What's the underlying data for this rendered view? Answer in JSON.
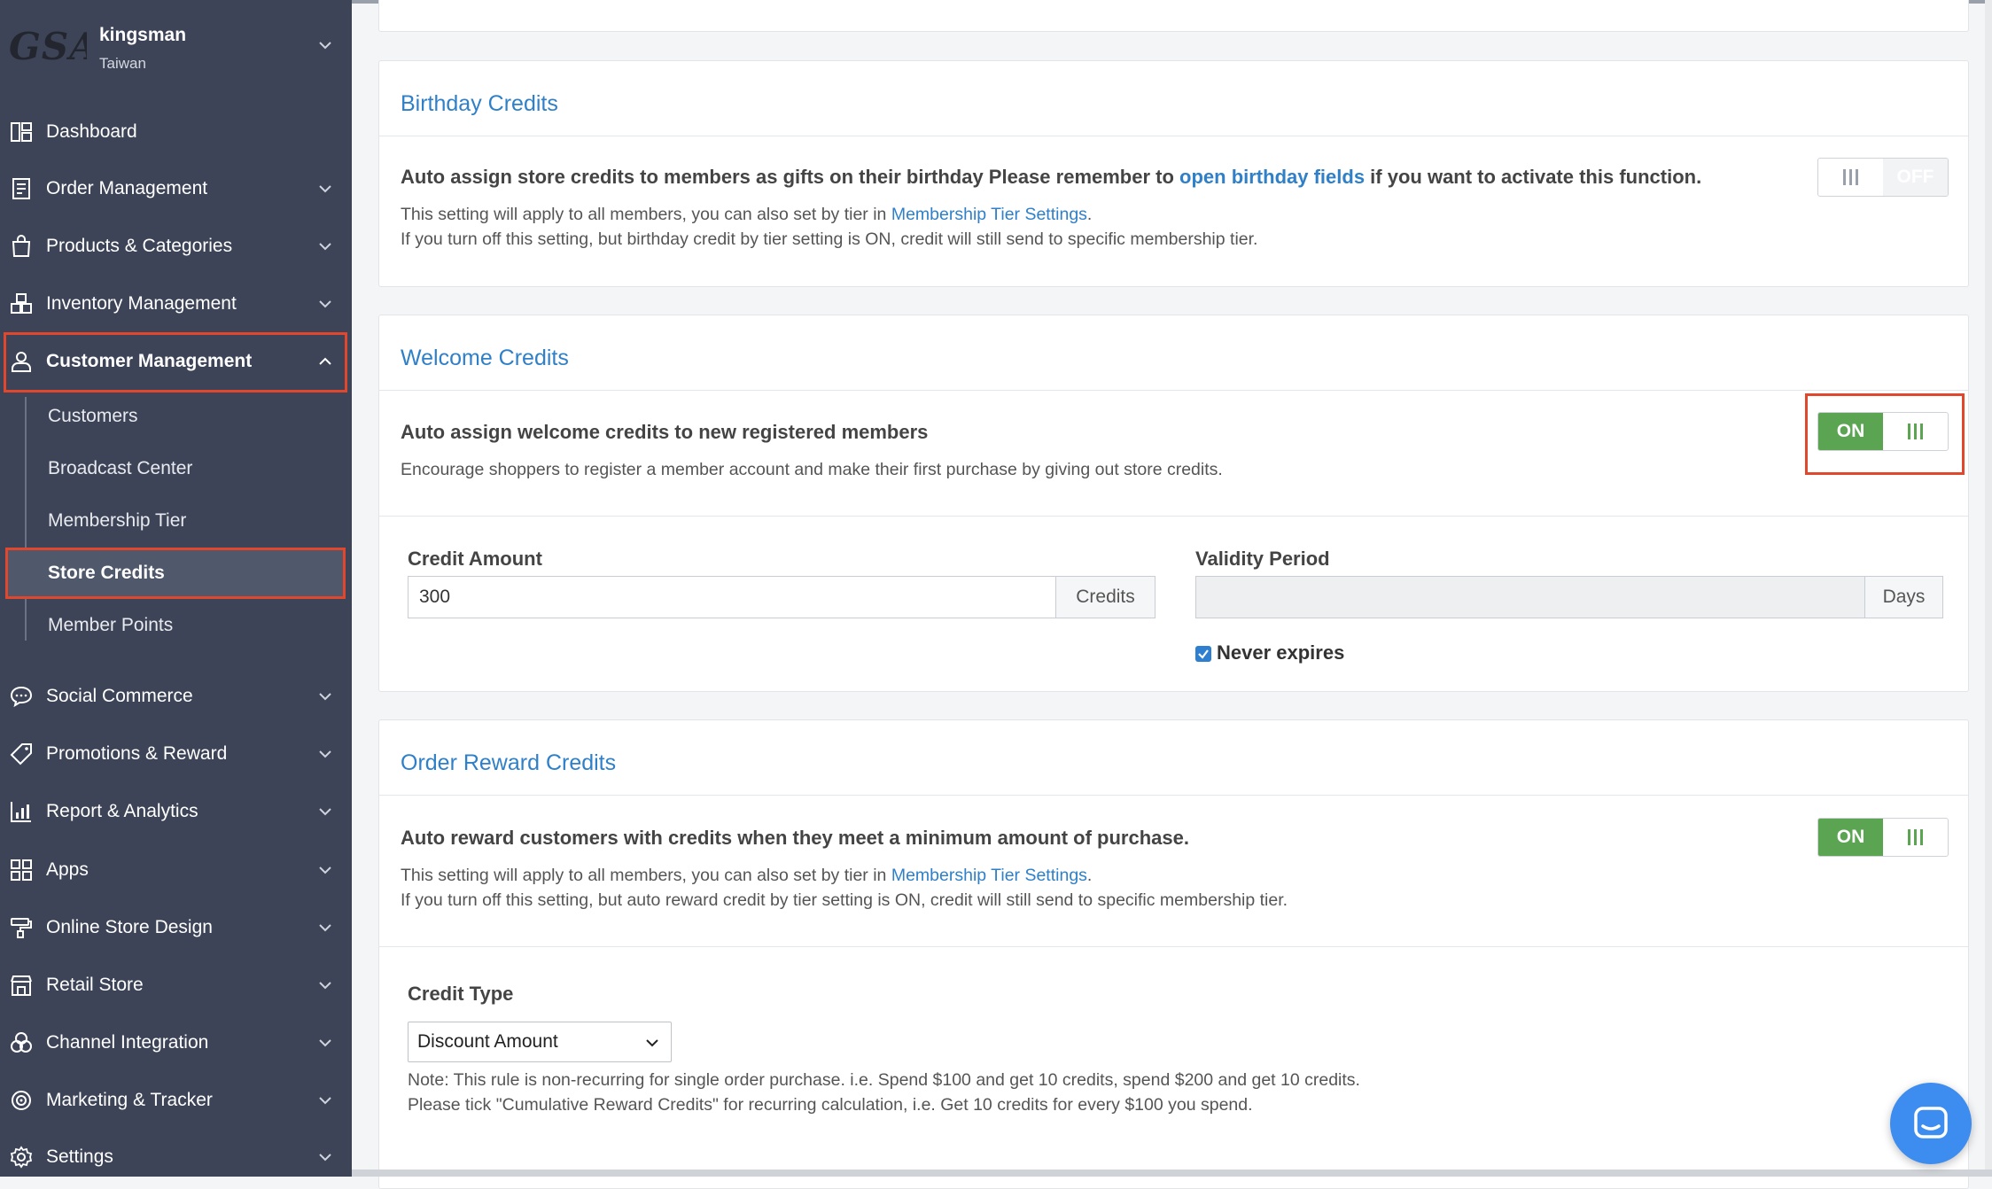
{
  "store": {
    "logo_text": "GSA",
    "name": "kingsman",
    "region": "Taiwan"
  },
  "sidebar": {
    "items": [
      {
        "label": "Dashboard",
        "icon": "dashboard-icon"
      },
      {
        "label": "Order Management",
        "icon": "receipt-icon"
      },
      {
        "label": "Products & Categories",
        "icon": "shopping-bag-icon"
      },
      {
        "label": "Inventory Management",
        "icon": "boxes-icon"
      },
      {
        "label": "Customer Management",
        "icon": "user-icon"
      },
      {
        "label": "Social Commerce",
        "icon": "chat-bubble-icon"
      },
      {
        "label": "Promotions & Reward",
        "icon": "tag-icon"
      },
      {
        "label": "Report & Analytics",
        "icon": "bar-chart-icon"
      },
      {
        "label": "Apps",
        "icon": "apps-grid-icon"
      },
      {
        "label": "Online Store Design",
        "icon": "paint-roller-icon"
      },
      {
        "label": "Retail Store",
        "icon": "store-icon"
      },
      {
        "label": "Channel Integration",
        "icon": "channels-icon"
      },
      {
        "label": "Marketing & Tracker",
        "icon": "target-icon"
      },
      {
        "label": "Settings",
        "icon": "gear-icon"
      }
    ],
    "sub_items": [
      "Customers",
      "Broadcast Center",
      "Membership Tier",
      "Store Credits",
      "Member Points"
    ]
  },
  "birthday": {
    "title": "Birthday Credits",
    "desc_before": "Auto assign store credits to members as gifts on their birthday Please remember to ",
    "desc_link": "open birthday fields",
    "desc_after": " if you want to activate this function.",
    "note1_before": "This setting will apply to all members, you can also set by tier in ",
    "note1_link": "Membership Tier Settings",
    "note1_after": ".",
    "note2": "If you turn off this setting, but birthday credit by tier setting is ON, credit will still send to specific membership tier.",
    "toggle_label": "OFF"
  },
  "welcome": {
    "title": "Welcome Credits",
    "desc": "Auto assign welcome credits to new registered members",
    "note": "Encourage shoppers to register a member account and make their first purchase by giving out store credits.",
    "toggle_label": "ON",
    "credit_amount_label": "Credit Amount",
    "credit_amount_value": "300",
    "credit_unit": "Credits",
    "validity_label": "Validity Period",
    "validity_value": "",
    "validity_unit": "Days",
    "never_expires_label": "Never expires"
  },
  "order_reward": {
    "title": "Order Reward Credits",
    "desc": "Auto reward customers with credits when they meet a minimum amount of purchase.",
    "note1_before": "This setting will apply to all members, you can also set by tier in ",
    "note1_link": "Membership Tier Settings",
    "note1_after": ".",
    "note2": "If you turn off this setting, but auto reward credit by tier setting is ON, credit will still send to specific membership tier.",
    "toggle_label": "ON",
    "credit_type_label": "Credit Type",
    "credit_type_value": "Discount Amount",
    "rule_note1": "Note: This rule is non-recurring for single order purchase. i.e. Spend $100 and get 10 credits, spend $200 and get 10 credits.",
    "rule_note2": "Please tick \"Cumulative Reward Credits\" for recurring calculation, i.e. Get 10 credits for every $100 you spend."
  },
  "colors": {
    "sidebar_bg": "#3d4457",
    "accent_blue": "#2f80c8",
    "toggle_green": "#5aa452",
    "highlight_red": "#e0472c"
  }
}
